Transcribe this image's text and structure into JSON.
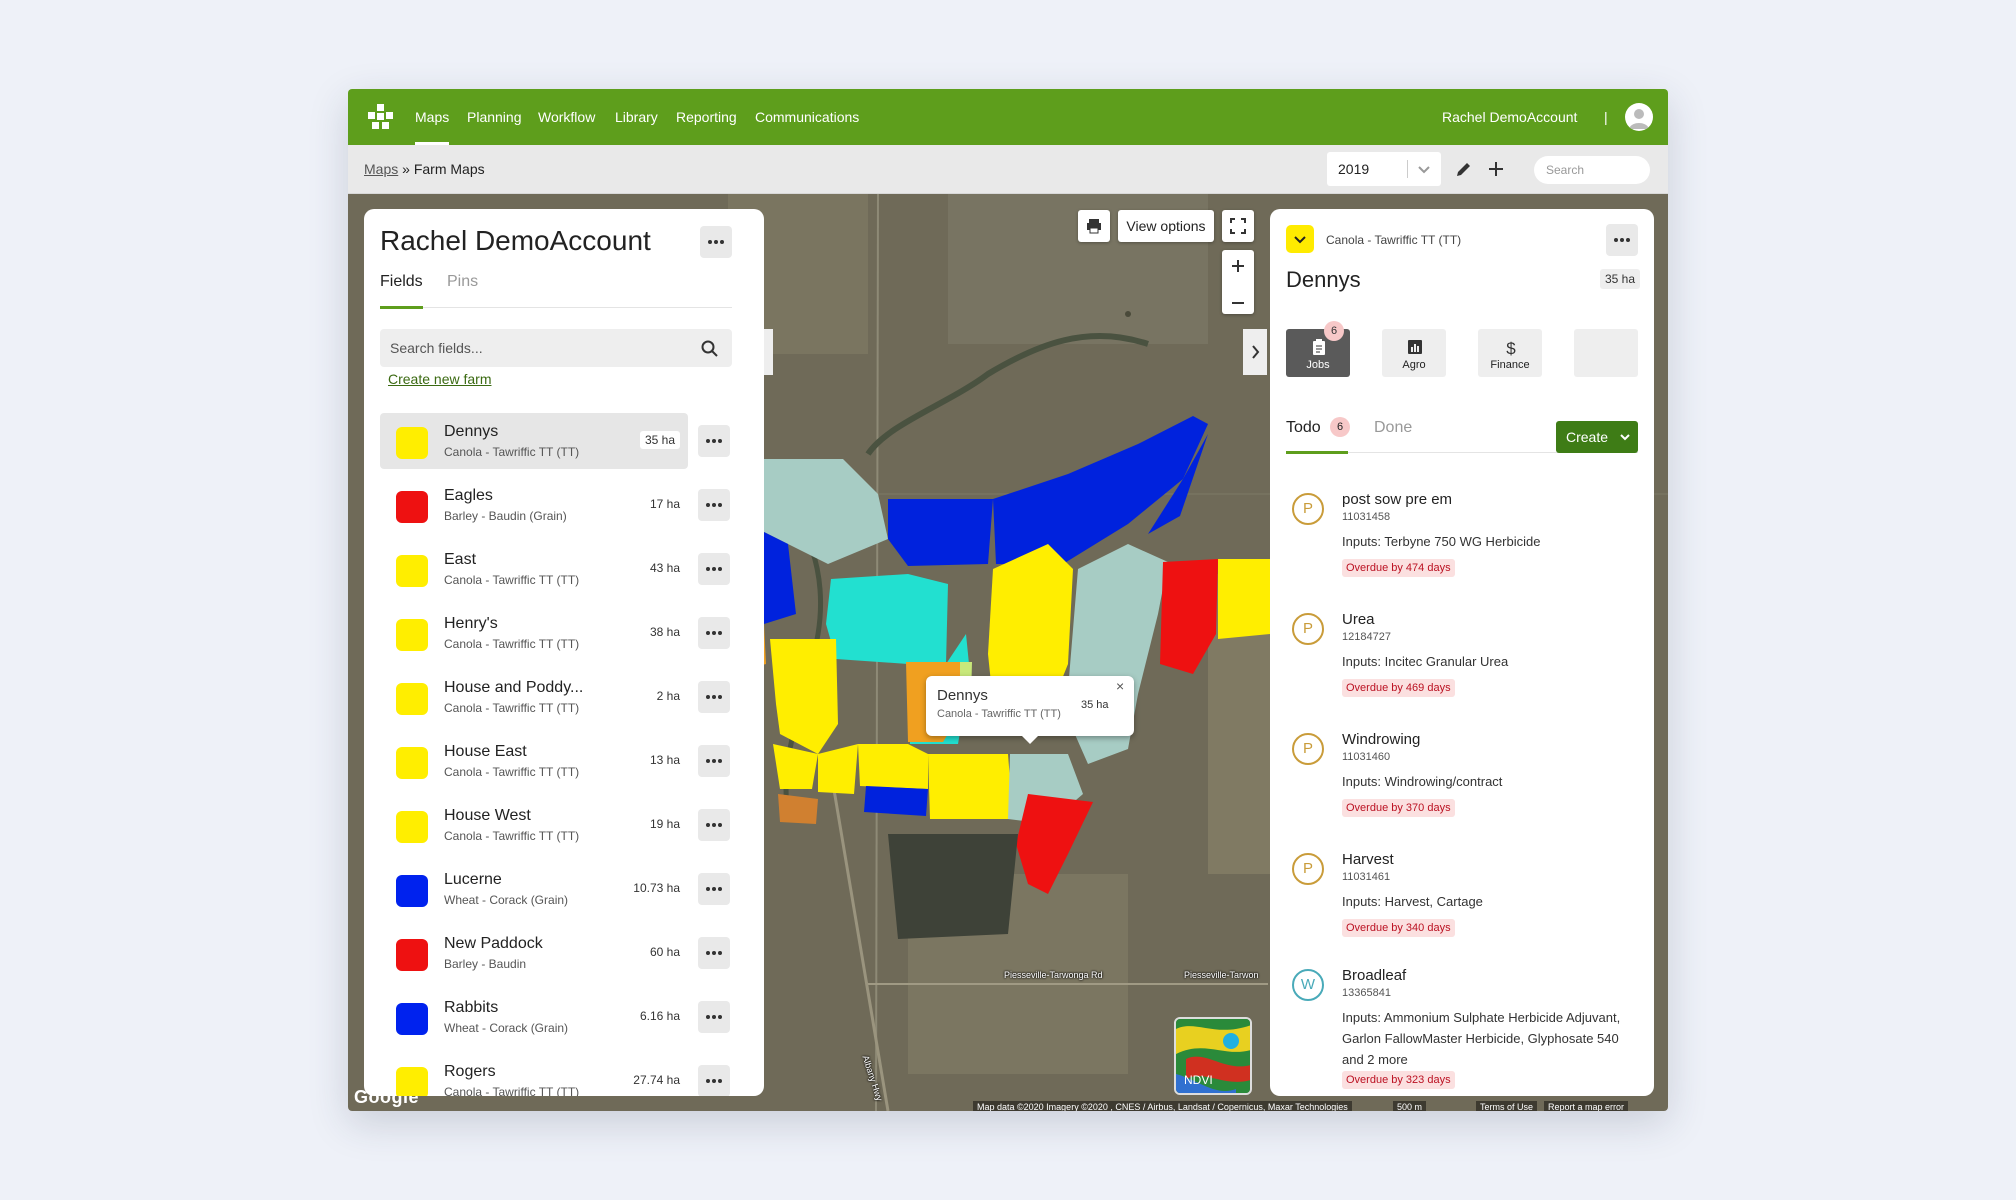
{
  "nav": {
    "items": [
      "Maps",
      "Planning",
      "Workflow",
      "Library",
      "Reporting",
      "Communications"
    ],
    "active": "Maps",
    "user": "Rachel DemoAccount",
    "separator": "|"
  },
  "breadcrumb": {
    "root": "Maps",
    "sep": "»",
    "current": "Farm Maps"
  },
  "toolbar": {
    "year": "2019",
    "search_placeholder": "Search"
  },
  "left_panel": {
    "title": "Rachel DemoAccount",
    "tabs": [
      "Fields",
      "Pins"
    ],
    "search_placeholder": "Search fields...",
    "create_farm": "Create new farm",
    "fields": [
      {
        "name": "Dennys",
        "crop": "Canola - Tawriffic TT (TT)",
        "area": "35 ha",
        "color": "#ffee00",
        "selected": true
      },
      {
        "name": "Eagles",
        "crop": "Barley - Baudin (Grain)",
        "area": "17 ha",
        "color": "#ee1111"
      },
      {
        "name": "East",
        "crop": "Canola - Tawriffic TT (TT)",
        "area": "43 ha",
        "color": "#ffee00"
      },
      {
        "name": "Henry's",
        "crop": "Canola - Tawriffic TT (TT)",
        "area": "38 ha",
        "color": "#ffee00"
      },
      {
        "name": "House and Poddy...",
        "crop": "Canola - Tawriffic TT (TT)",
        "area": "2 ha",
        "color": "#ffee00"
      },
      {
        "name": "House East",
        "crop": "Canola - Tawriffic TT (TT)",
        "area": "13 ha",
        "color": "#ffee00"
      },
      {
        "name": "House West",
        "crop": "Canola - Tawriffic TT (TT)",
        "area": "19 ha",
        "color": "#ffee00"
      },
      {
        "name": "Lucerne",
        "crop": "Wheat - Corack (Grain)",
        "area": "10.73 ha",
        "color": "#0022ee"
      },
      {
        "name": "New Paddock",
        "crop": "Barley - Baudin",
        "area": "60 ha",
        "color": "#ee1111"
      },
      {
        "name": "Rabbits",
        "crop": "Wheat - Corack (Grain)",
        "area": "6.16 ha",
        "color": "#0022ee"
      },
      {
        "name": "Rogers",
        "crop": "Canola - Tawriffic TT (TT)",
        "area": "27.74 ha",
        "color": "#ffee00"
      }
    ]
  },
  "map": {
    "view_options": "View options",
    "popup": {
      "name": "Dennys",
      "crop": "Canola - Tawriffic TT (TT)",
      "area": "35 ha",
      "close": "×"
    },
    "ndvi": "NDVI",
    "google": "Google",
    "road1": "Piesseville-Tarwonga Rd",
    "road2": "Piesseville-Tarwon",
    "road3": "Albany Hwy",
    "attribution": "Map data ©2020 Imagery ©2020 , CNES / Airbus, Landsat / Copernicus, Maxar Technologies",
    "scale": "500 m",
    "terms": "Terms of Use",
    "report": "Report a map error"
  },
  "right_panel": {
    "crop": "Canola - Tawriffic TT (TT)",
    "title": "Dennys",
    "area": "35 ha",
    "tiles": [
      "Jobs",
      "Agro",
      "Finance"
    ],
    "jobs_badge": "6",
    "todo_label": "Todo",
    "todo_count": "6",
    "done_label": "Done",
    "create_label": "Create",
    "jobs": [
      {
        "icon": "P",
        "name": "post sow pre em",
        "id": "11031458",
        "inputs": "Inputs: Terbyne 750 WG Herbicide",
        "overdue": "Overdue by 474 days"
      },
      {
        "icon": "P",
        "name": "Urea",
        "id": "12184727",
        "inputs": "Inputs: Incitec Granular Urea",
        "overdue": "Overdue by 469 days"
      },
      {
        "icon": "P",
        "name": "Windrowing",
        "id": "11031460",
        "inputs": "Inputs: Windrowing/contract",
        "overdue": "Overdue by 370 days"
      },
      {
        "icon": "P",
        "name": "Harvest",
        "id": "11031461",
        "inputs": "Inputs: Harvest, Cartage",
        "overdue": "Overdue by 340 days"
      },
      {
        "icon": "W",
        "name": "Broadleaf",
        "id": "13365841",
        "inputs": "Inputs: Ammonium Sulphate Herbicide Adjuvant, Garlon FallowMaster Herbicide, Glyphosate 540 and 2 more",
        "overdue": "Overdue by 323 days"
      }
    ]
  }
}
